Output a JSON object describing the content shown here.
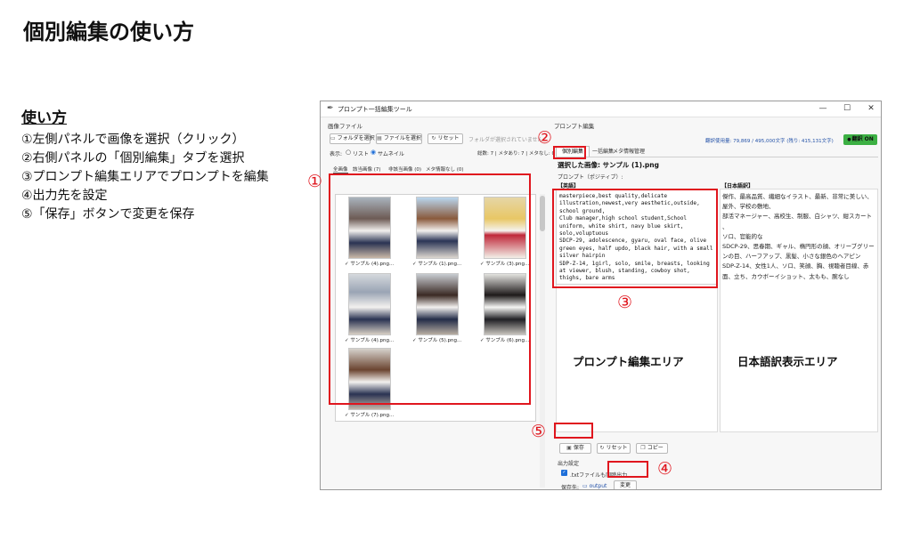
{
  "slide": {
    "title": "個別編集の使い方",
    "howto_title": "使い方",
    "steps": [
      "①左側パネルで画像を選択（クリック）",
      "②右側パネルの「個別編集」タブを選択",
      "③プロンプト編集エリアでプロンプトを編集",
      "④出力先を設定",
      "⑤「保存」ボタンで変更を保存"
    ]
  },
  "window": {
    "title": "プロンプト一括編集ツール",
    "icons": {
      "app": "feather-icon",
      "min": "minimize-icon",
      "max": "maximize-icon",
      "close": "close-icon"
    },
    "minimize": "—",
    "maximize": "☐",
    "close": "✕"
  },
  "left": {
    "section": "画像ファイル",
    "folder_button": "フォルダを選択",
    "file_button": "ファイルを選択",
    "reset_button": "リセット",
    "status": "フォルダが選択されていません",
    "display_label": "表示:",
    "radio_list": "リスト",
    "radio_thumb": "サムネイル",
    "counts": "総数: 7 | メタあり: 7 | メタなし: 0",
    "filters": [
      "全画像",
      "該当画像 (7)",
      "非該当画像 (0)",
      "メタ情報なし (0)"
    ],
    "thumbnails": [
      {
        "caption": "✓ サンプル (4).png..."
      },
      {
        "caption": "✓ サンプル (1).png..."
      },
      {
        "caption": "✓ サンプル (3).png..."
      },
      {
        "caption": "✓ サンプル (4).png..."
      },
      {
        "caption": "✓ サンプル (5).png..."
      },
      {
        "caption": "✓ サンプル (6).png..."
      },
      {
        "caption": "✓ サンプル (7).png..."
      }
    ]
  },
  "right": {
    "section": "プロンプト編集",
    "usage": "翻訳使用量: 79,869 / 495,000文字 (残り: 415,131文字)",
    "translate_toggle": "翻訳 ON",
    "tabs": [
      "個別編集",
      "一括編集",
      "メタ情報管理"
    ],
    "selected_image": "選択した画像: サンプル (1).png",
    "prompt_label": "プロンプト（ポジティブ）:",
    "en_header": "【英語】",
    "prompt_text": "masterpiece,best quality,delicate illustration,newest,very aesthetic,outside, school ground,\nClub manager,high school student,School uniform, white shirt, navy blue skirt,\nsolo,voluptuous\nSDCP-29, adolescence, gyaru, oval face, olive green eyes, half updo, black hair, with a small silver hairpin\nSDP-Z-14, 1girl, solo, smile, breasts, looking at viewer, blush, standing, cowboy shot, thighs, bare arms",
    "jp_header": "【日本語訳】",
    "jp_text": "傑作、最高品質、繊細なイラスト、最新、非常に美しい、屋外、学校の敷地、\n部活マネージャー、高校生、制服、白シャツ、紺スカート\n、\nソロ、官能的な\nSDCP-29、思春期、ギャル、楕円形の顔、オリーブグリーンの目、ハーフアップ、黒髪、小さな銀色のヘアピン\nSDP-Z-14、女性1人、ソロ、笑顔、胸、視聴者目線、赤面、立ち、カウボーイショット、太もも、腕なし",
    "save_button": "保存",
    "reset_button": "リセット",
    "copy_button": "コピー",
    "output_section": "出力設定",
    "txt_checkbox": ".txtファイルも同時出力",
    "save_dest_label": "保存先:",
    "save_dest_value": "output",
    "change_button": "変更"
  },
  "annotations": {
    "m1": "①",
    "m2": "②",
    "m3": "③",
    "m4": "④",
    "m5": "⑤",
    "prompt_area": "プロンプト編集エリア",
    "jp_area": "日本語訳表示エリア"
  },
  "colors": {
    "annotation_red": "#e0161e",
    "toggle_green": "#3cb043",
    "checkbox_blue": "#1e6fd9"
  }
}
